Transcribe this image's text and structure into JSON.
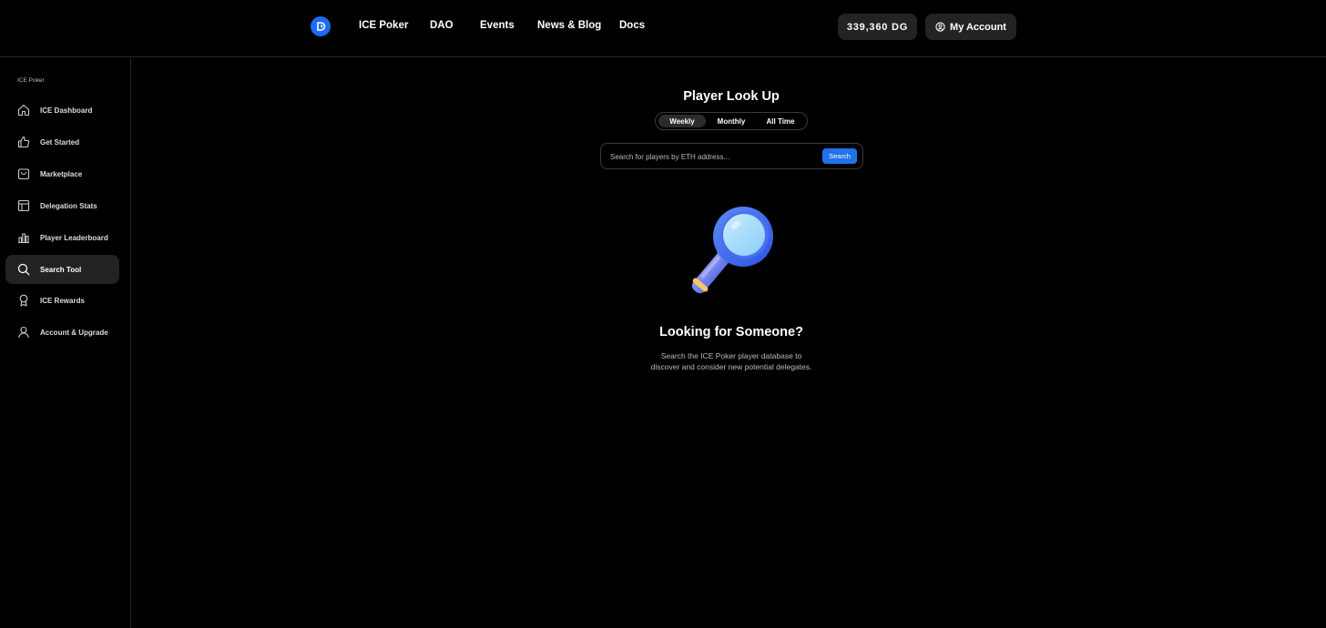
{
  "header": {
    "nav": [
      {
        "label": "ICE Poker"
      },
      {
        "label": "DAO"
      },
      {
        "label": "Events"
      },
      {
        "label": "News & Blog"
      },
      {
        "label": "Docs"
      }
    ],
    "balance": "339,360 DG",
    "account_label": "My Account"
  },
  "sidebar": {
    "heading": "ICE Poker",
    "items": [
      {
        "label": "ICE Dashboard",
        "icon": "home-icon"
      },
      {
        "label": "Get Started",
        "icon": "thumbs-up-icon"
      },
      {
        "label": "Marketplace",
        "icon": "shopping-bag-icon"
      },
      {
        "label": "Delegation Stats",
        "icon": "layout-icon"
      },
      {
        "label": "Player Leaderboard",
        "icon": "bar-chart-icon"
      },
      {
        "label": "Search Tool",
        "icon": "search-icon",
        "active": true
      },
      {
        "label": "ICE Rewards",
        "icon": "award-icon"
      },
      {
        "label": "Account & Upgrade",
        "icon": "user-icon"
      }
    ]
  },
  "main": {
    "title": "Player Look Up",
    "tabs": [
      {
        "label": "Weekly",
        "active": true
      },
      {
        "label": "Monthly"
      },
      {
        "label": "All Time"
      }
    ],
    "search": {
      "placeholder": "Search for players by ETH address...",
      "button_label": "Search"
    },
    "empty_state": {
      "title": "Looking for Someone?",
      "line1": "Search the ICE Poker player database to",
      "line2": "discover and consider new potential delegates."
    }
  },
  "colors": {
    "accent": "#1f72e8",
    "background": "#000000",
    "active_item": "#222222"
  }
}
